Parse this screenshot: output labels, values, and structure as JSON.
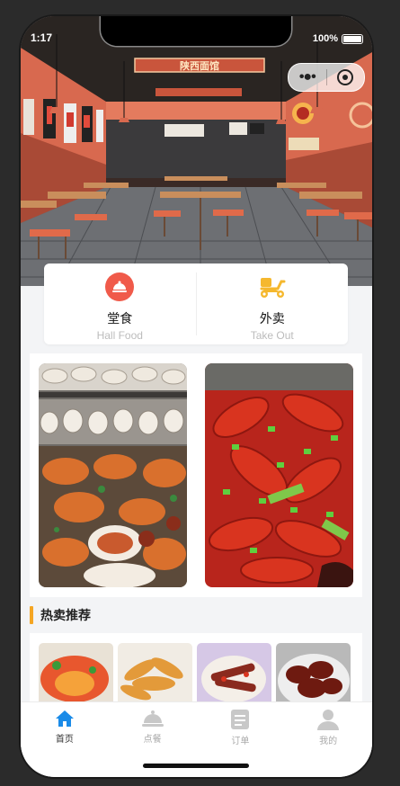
{
  "status": {
    "time": "1:17",
    "battery": "100%"
  },
  "capsule": {
    "more_icon": "more-dots-icon",
    "close_icon": "target-circle-icon"
  },
  "hero": {
    "sign_text": "陕西面馆"
  },
  "service_card": {
    "dine_in": {
      "title": "堂食",
      "subtitle": "Hall Food",
      "icon": "dish-cloche-icon",
      "color": "#f05a4a"
    },
    "takeout": {
      "title": "外卖",
      "subtitle": "Take Out",
      "icon": "scooter-icon",
      "color": "#f5b82e"
    }
  },
  "gallery": {
    "images": [
      "seafood-platter",
      "spicy-crayfish"
    ]
  },
  "hot_section": {
    "title": "热卖推荐",
    "accent": "#f5a623",
    "items": [
      "lobster-dish",
      "fried-prawns",
      "braised-duck-neck",
      "braised-ribs"
    ]
  },
  "tabbar": {
    "tabs": [
      {
        "label": "首页",
        "icon": "home-icon",
        "active": true
      },
      {
        "label": "点餐",
        "icon": "cloche-icon",
        "active": false
      },
      {
        "label": "订单",
        "icon": "order-list-icon",
        "active": false
      },
      {
        "label": "我的",
        "icon": "user-icon",
        "active": false
      }
    ],
    "active_color": "#1a8be8",
    "inactive_color": "#c8c8c8"
  }
}
